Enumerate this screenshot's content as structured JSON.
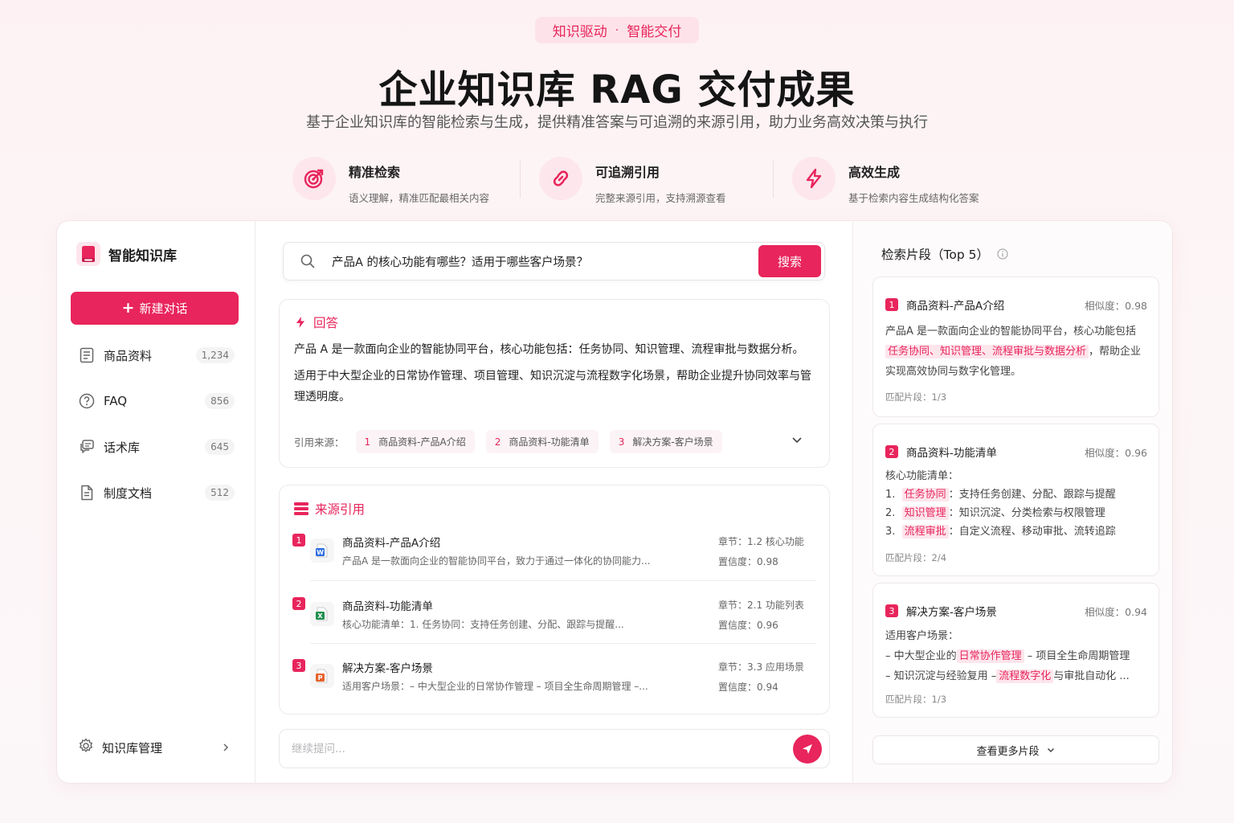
{
  "hero": {
    "tag_left": "知识驱动",
    "tag_dot": "·",
    "tag_right": "智能交付",
    "title": "企业知识库 RAG 交付成果",
    "subtitle": "基于企业知识库的智能检索与生成，提供精准答案与可追溯的来源引用，助力业务高效决策与执行",
    "features": [
      {
        "icon": "target-icon",
        "title": "精准检索",
        "desc": "语义理解，精准匹配最相关内容"
      },
      {
        "icon": "link-icon",
        "title": "可追溯引用",
        "desc": "完整来源引用，支持溯源查看"
      },
      {
        "icon": "lightning-icon",
        "title": "高效生成",
        "desc": "基于检索内容生成结构化答案"
      }
    ]
  },
  "sidebar": {
    "app_name": "智能知识库",
    "new_chat_label": "新建对话",
    "items": [
      {
        "label": "商品资料",
        "count": "1,234",
        "icon": "document-list-icon"
      },
      {
        "label": "FAQ",
        "count": "856",
        "icon": "question-circle-icon"
      },
      {
        "label": "话术库",
        "count": "645",
        "icon": "chat-bubbles-icon"
      },
      {
        "label": "制度文档",
        "count": "512",
        "icon": "file-icon"
      }
    ],
    "manage_label": "知识库管理"
  },
  "search": {
    "query": "产品A 的核心功能有哪些？适用于哪些客户场景？",
    "button_label": "搜索"
  },
  "answer": {
    "heading": "回答",
    "paragraph1": "产品 A 是一款面向企业的智能协同平台，核心功能包括：任务协同、知识管理、流程审批与数据分析。",
    "paragraph2": "适用于中大型企业的日常协作管理、项目管理、知识沉淀与流程数字化场景，帮助企业提升协同效率与管理透明度。",
    "cite_label": "引用来源：",
    "citations": [
      {
        "num": "1",
        "label": "商品资料-产品A介绍"
      },
      {
        "num": "2",
        "label": "商品资料-功能清单"
      },
      {
        "num": "3",
        "label": "解决方案-客户场景"
      }
    ]
  },
  "sources": {
    "heading": "来源引用",
    "items": [
      {
        "num": "1",
        "file_type": "W",
        "file_color": "#2b6be0",
        "title": "商品资料-产品A介绍",
        "snippet": "产品A 是一款面向企业的智能协同平台，致力于通过一体化的协同能力...",
        "chapter": "章节：1.2 核心功能",
        "confidence": "置信度：0.98"
      },
      {
        "num": "2",
        "file_type": "X",
        "file_color": "#1f8f4e",
        "title": "商品资料-功能清单",
        "snippet": "核心功能清单：1. 任务协同：支持任务创建、分配、跟踪与提醒...",
        "chapter": "章节：2.1 功能列表",
        "confidence": "置信度：0.96"
      },
      {
        "num": "3",
        "file_type": "P",
        "file_color": "#e5632b",
        "title": "解决方案-客户场景",
        "snippet": "适用客户场景：– 中大型企业的日常协作管理 – 项目全生命周期管理 –...",
        "chapter": "章节：3.3 应用场景",
        "confidence": "置信度：0.94"
      }
    ]
  },
  "followup": {
    "placeholder": "继续提问..."
  },
  "fragments": {
    "heading": "检索片段（Top 5）",
    "items": [
      {
        "num": "1",
        "title": "商品资料-产品A介绍",
        "similarity": "相似度：0.98",
        "line1": "产品A 是一款面向企业的智能协同平台，核心功能包括",
        "hl1": "任务协同、知识管理、流程审批与数据分析",
        "line2_tail": "，帮助企业",
        "line3": "实现高效协同与数字化管理。",
        "match": "匹配片段：1/3"
      },
      {
        "num": "2",
        "title": "商品资料-功能清单",
        "similarity": "相似度：0.96",
        "intro": "核心功能清单：",
        "list": [
          {
            "idx": "1.",
            "key": "任务协同",
            "text": "：支持任务创建、分配、跟踪与提醒"
          },
          {
            "idx": "2.",
            "key": "知识管理",
            "text": "：知识沉淀、分类检索与权限管理"
          },
          {
            "idx": "3.",
            "key": "流程审批",
            "text": "：自定义流程、移动审批、流转追踪"
          }
        ],
        "match": "匹配片段：2/4"
      },
      {
        "num": "3",
        "title": "解决方案-客户场景",
        "similarity": "相似度：0.94",
        "intro": "适用客户场景：",
        "l1_pre": "– 中大型企业的",
        "l1_hl": "日常协作管理",
        "l1_post": " – 项目全生命周期管理",
        "l2_pre": "– 知识沉淀与经验复用 –",
        "l2_hl": "流程数字化",
        "l2_post": "与审批自动化 ...",
        "match": "匹配片段：1/3"
      }
    ],
    "more_label": "查看更多片段"
  },
  "colors": {
    "accent": "#e8255c",
    "accent_soft": "#fde5ec"
  }
}
